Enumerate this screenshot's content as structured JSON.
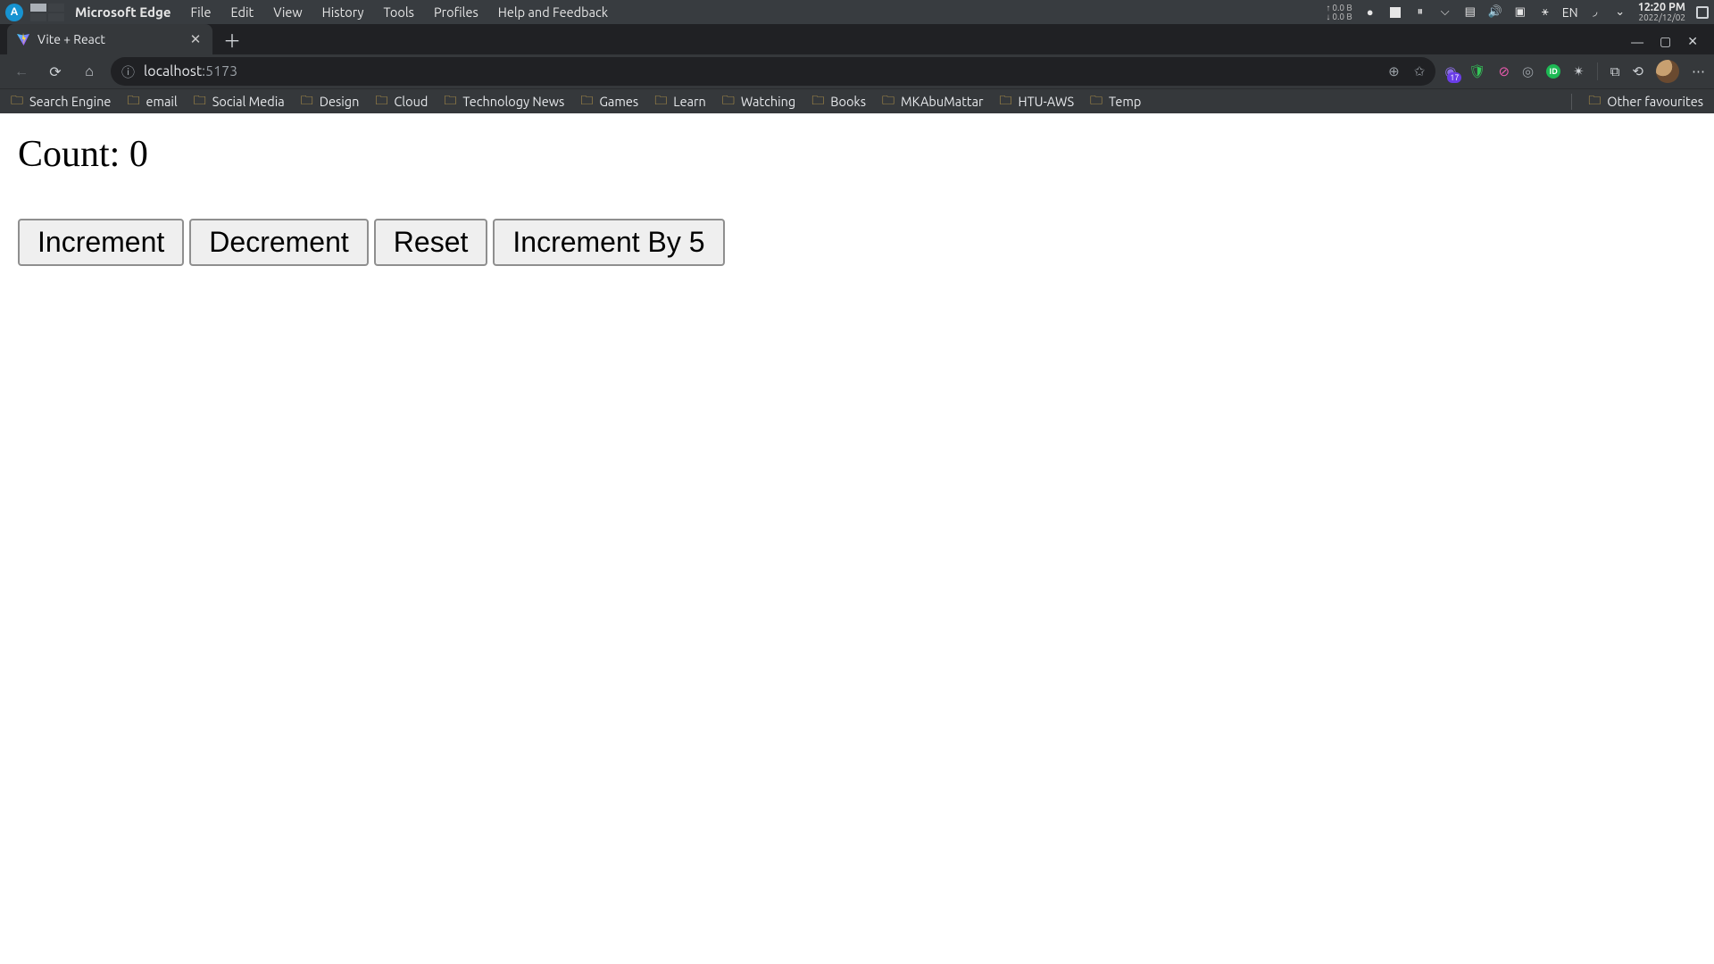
{
  "os_panel": {
    "app_name": "Microsoft Edge",
    "menus": [
      "File",
      "Edit",
      "View",
      "History",
      "Tools",
      "Profiles",
      "Help and Feedback"
    ],
    "net_up": "0.0 B",
    "net_down": "0.0 B",
    "lang": "EN",
    "time": "12:20 PM",
    "date": "2022/12/02"
  },
  "browser": {
    "tab_title": "Vite + React",
    "url_host": "localhost",
    "url_port": ":5173",
    "ext_badge": "17",
    "bookmarks": [
      "Search Engine",
      "email",
      "Social Media",
      "Design",
      "Cloud",
      "Technology News",
      "Games",
      "Learn",
      "Watching",
      "Books",
      "MKAbuMattar",
      "HTU-AWS",
      "Temp"
    ],
    "other_favourites": "Other favourites"
  },
  "page": {
    "count_label": "Count: ",
    "count_value": "0",
    "buttons": {
      "increment": "Increment",
      "decrement": "Decrement",
      "reset": "Reset",
      "increment_by_5": "Increment By 5"
    }
  }
}
